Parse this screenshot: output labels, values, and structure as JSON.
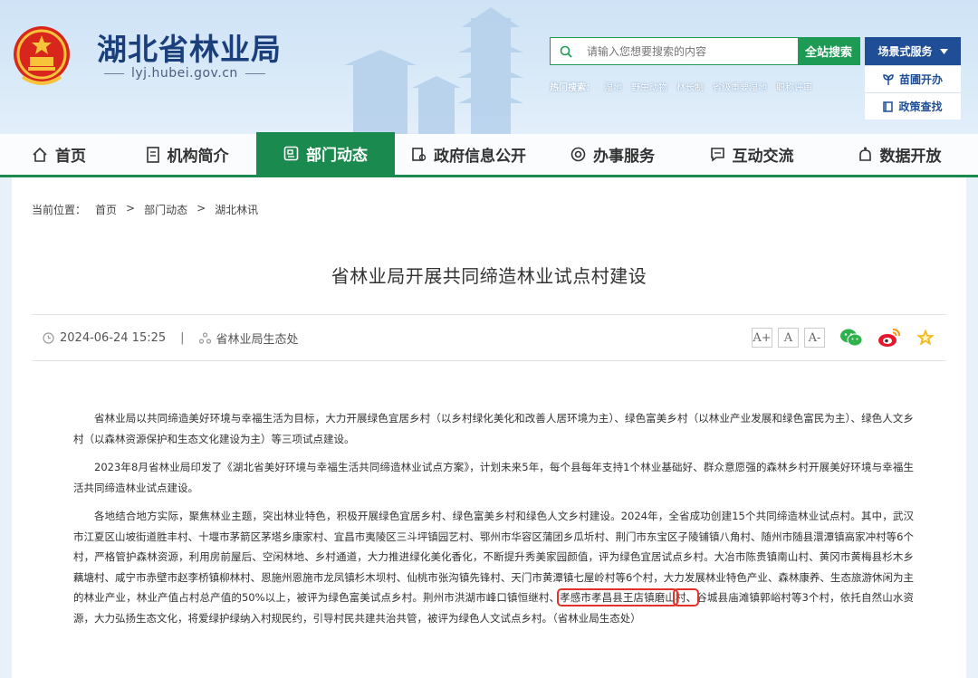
{
  "site": {
    "title": "湖北省林业局",
    "domain": "lyj.hubei.gov.cn"
  },
  "search": {
    "placeholder": "请输入您想要搜索的内容",
    "button": "全站搜索"
  },
  "hot_search": {
    "label": "热门搜索：",
    "items": [
      "湿地",
      "野生动物",
      "林长制",
      "省级重要湿地",
      "职称评审"
    ]
  },
  "scene": {
    "button": "场景式服务",
    "items": [
      "苗圃开办",
      "政策查找"
    ]
  },
  "nav": [
    {
      "label": "首页",
      "icon": "home-icon"
    },
    {
      "label": "机构简介",
      "icon": "document-icon"
    },
    {
      "label": "部门动态",
      "icon": "news-icon"
    },
    {
      "label": "政府信息公开",
      "icon": "folder-icon"
    },
    {
      "label": "办事服务",
      "icon": "service-icon"
    },
    {
      "label": "互动交流",
      "icon": "chat-icon"
    },
    {
      "label": "数据开放",
      "icon": "data-icon"
    }
  ],
  "breadcrumb": {
    "label": "当前位置：",
    "items": [
      "首页",
      "部门动态",
      "湖北林讯"
    ],
    "sep": ">"
  },
  "article": {
    "title": "省林业局开展共同缔造林业试点村建设",
    "date": "2024-06-24 15:25",
    "sep": "|",
    "source": "省林业局生态处",
    "font_buttons": [
      "A+",
      "A",
      "A-"
    ],
    "p1": "省林业局以共同缔造美好环境与幸福生活为目标，大力开展绿色宜居乡村（以乡村绿化美化和改善人居环境为主）、绿色富美乡村（以林业产业发展和绿色富民为主）、绿色人文乡村（以森林资源保护和生态文化建设为主）等三项试点建设。",
    "p2": "2023年8月省林业局印发了《湖北省美好环境与幸福生活共同缔造林业试点方案》，计划未来5年，每个县每年支持1个林业基础好、群众意愿强的森林乡村开展美好环境与幸福生活共同缔造林业试点建设。",
    "p3_a": "各地结合地方实际，聚焦林业主题，突出林业特色，积极开展绿色宜居乡村、绿色富美乡村和绿色人文乡村建设。2024年，全省成功创建15个共同缔造林业试点村。其中，武汉市江夏区山坡街道胜丰村、十堰市茅箭区茅塔乡康家村、宜昌市夷陵区三斗坪镇园艺村、鄂州市华容区蒲团乡瓜圻村、荆门市东宝区子陵铺镇八角村、随州市随县澴潭镇高家冲村等6个村，严格管护森林资源，利用房前屋后、空闲林地、乡村通道，大力推进绿化美化香化，不断提升秀美家园颜值，评为绿色宜居试点乡村。大冶市陈贵镇南山村、黄冈市黄梅县杉木乡藕塘村、咸宁市赤壁市赵李桥镇柳林村、恩施州恩施市龙凤镇杉木坝村、仙桃市张沟镇先锋村、天门市黄潭镇七屋岭村等6个村，大力发展林业特色产业、森林康养、生态旅游休闲为主的林业产业，林业产值占村总产值的50%以上，被评为绿色富美试点乡村。荆州市洪湖市峰口镇恒继村、",
    "p3_hl1": "孝感市孝昌县王店镇磨山",
    "p3_hl2": "村、",
    "p3_b": "谷城县庙滩镇郭峪村等3个村，依托自然山水资源，大力弘扬生态文化，将爱绿护绿纳入村规民约，引导村民共建共治共管，被评为绿色人文试点乡村。（省林业局生态处）"
  },
  "colors": {
    "green": "#1a8a4e",
    "navy": "#1f4e96",
    "highlight": "#e0342b"
  }
}
